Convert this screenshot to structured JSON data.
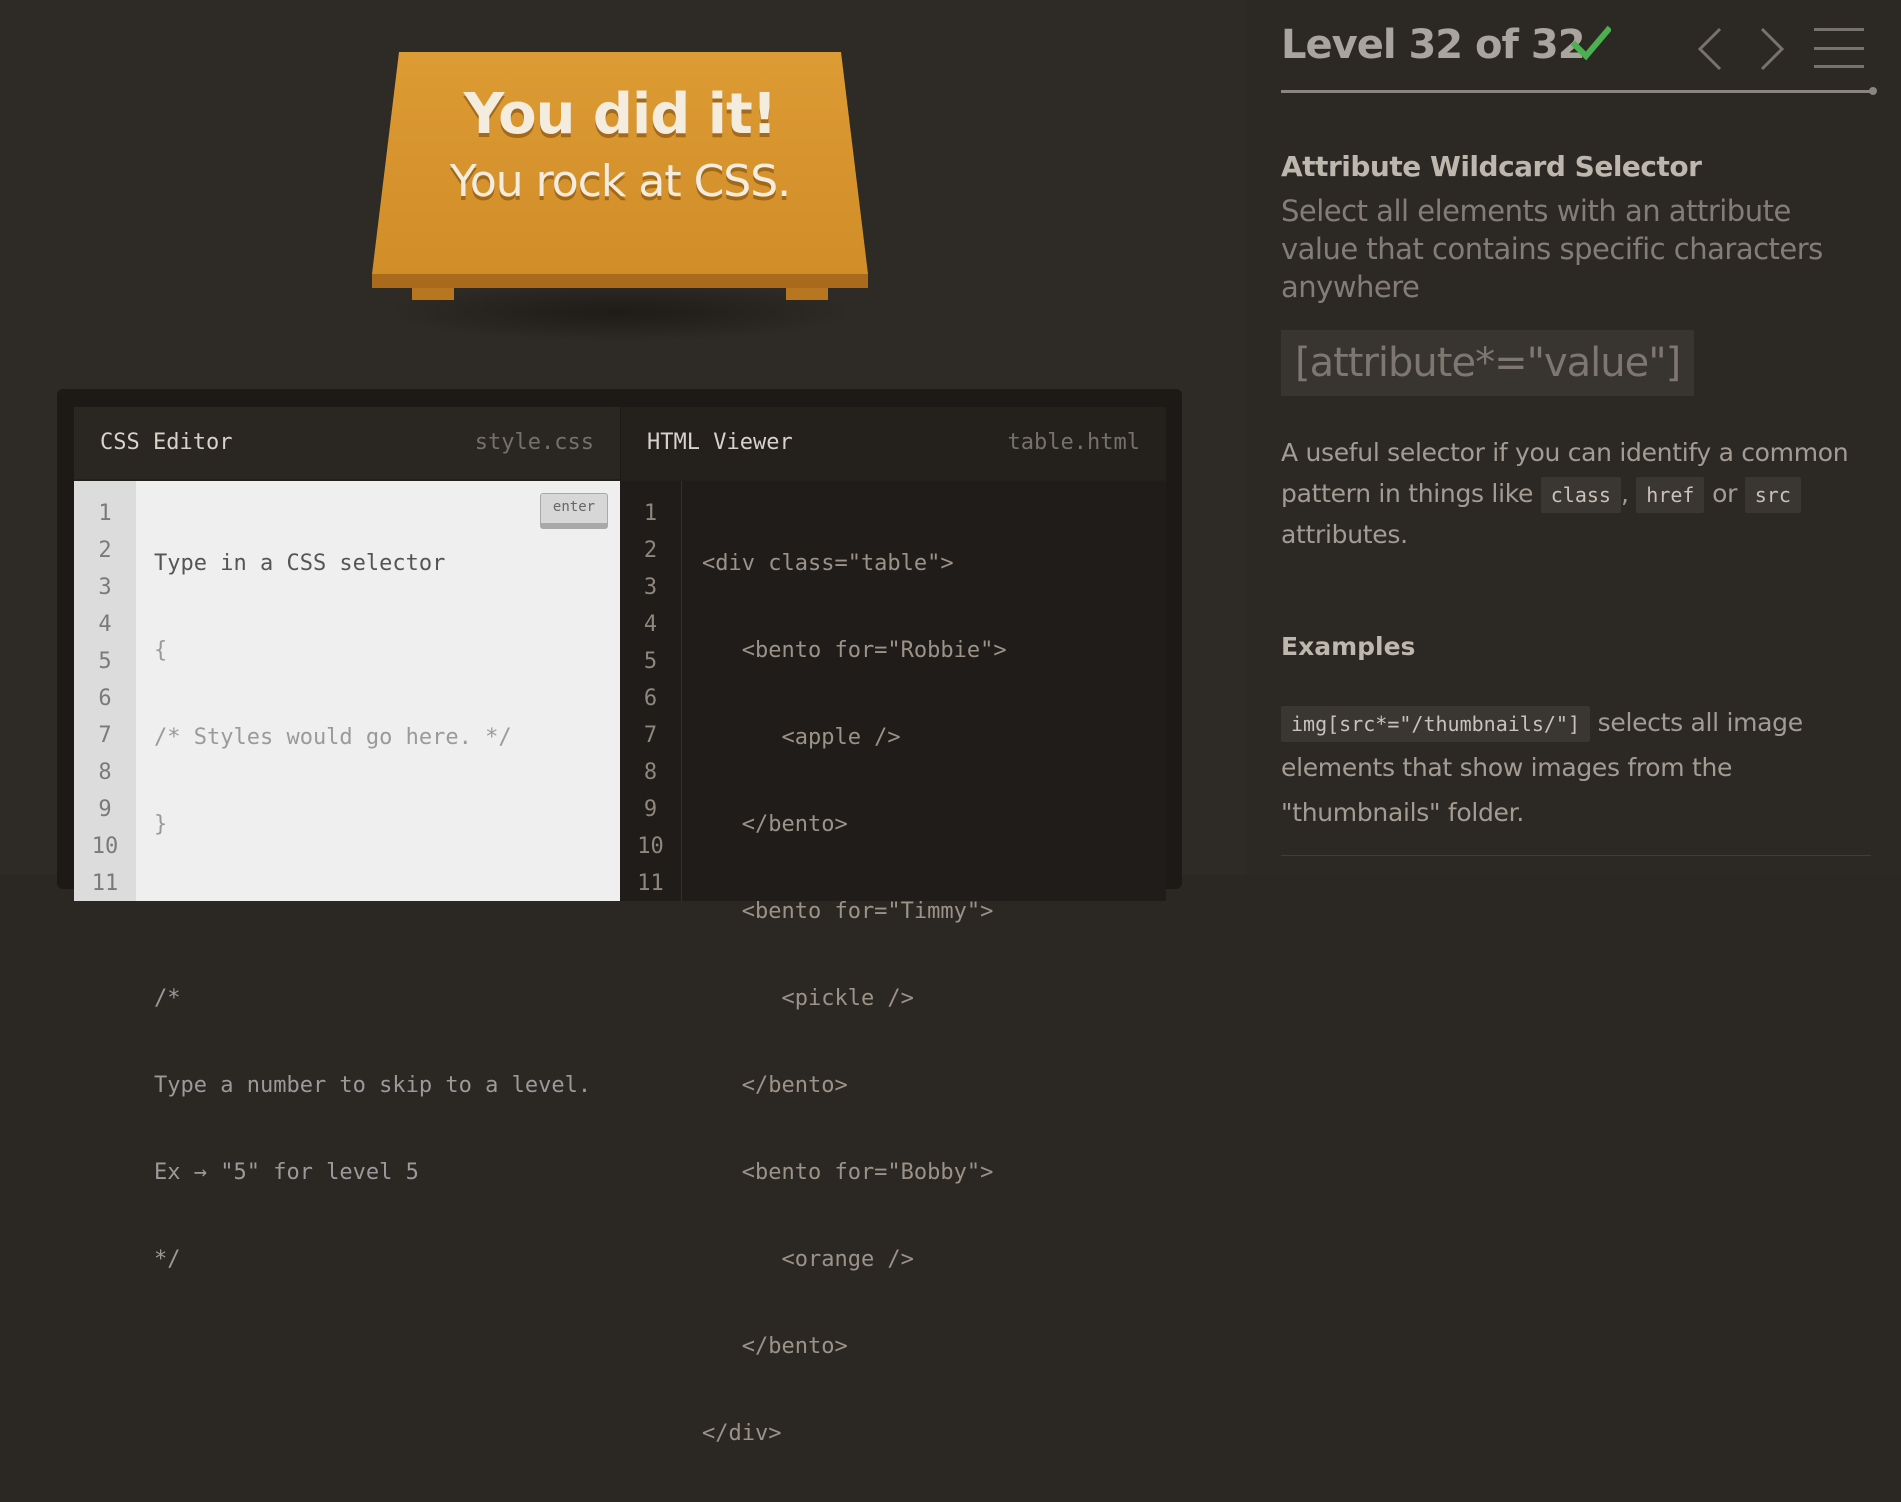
{
  "win": {
    "title": "You did it!",
    "subtitle": "You rock at CSS."
  },
  "css_editor": {
    "title": "CSS Editor",
    "file": "style.css",
    "enter_label": "enter",
    "line_numbers": [
      "1",
      "2",
      "3",
      "4",
      "5",
      "6",
      "7",
      "8",
      "9",
      "10",
      "11"
    ],
    "lines": [
      "Type in a CSS selector",
      "{",
      "/* Styles would go here. */",
      "}",
      "",
      "/*",
      "Type a number to skip to a level.",
      "Ex → \"5\" for level 5",
      "*/",
      "",
      ""
    ]
  },
  "html_viewer": {
    "title": "HTML Viewer",
    "file": "table.html",
    "line_numbers": [
      "1",
      "2",
      "3",
      "4",
      "5",
      "6",
      "7",
      "8",
      "9",
      "10",
      "11"
    ],
    "lines": [
      "<div class=\"table\">",
      "   <bento for=\"Robbie\">",
      "      <apple />",
      "   </bento>",
      "   <bento for=\"Timmy\">",
      "      <pickle />",
      "   </bento>",
      "   <bento for=\"Bobby\">",
      "      <orange />",
      "   </bento>",
      "</div>"
    ]
  },
  "sidebar": {
    "level_title": "Level 32 of 32",
    "check_icon": "check-icon",
    "check_color": "#4caf50",
    "progress": 1.0,
    "selector_name": "Attribute Wildcard Selector",
    "selector_desc": "Select all elements with an attribute value that contains specific characters anywhere",
    "syntax": "[attribute*=\"value\"]",
    "hint_part1": "A useful selector if you can identify a common pattern in things like",
    "hint_chip1": "class",
    "hint_sep1": ",",
    "hint_chip2": "href",
    "hint_sep2": "or",
    "hint_chip3": "src",
    "hint_part2": "attributes.",
    "examples_title": "Examples",
    "example_code": "img[src*=\"/thumbnails/\"]",
    "example_text": "selects all image elements that show images from the \"thumbnails\" folder."
  }
}
